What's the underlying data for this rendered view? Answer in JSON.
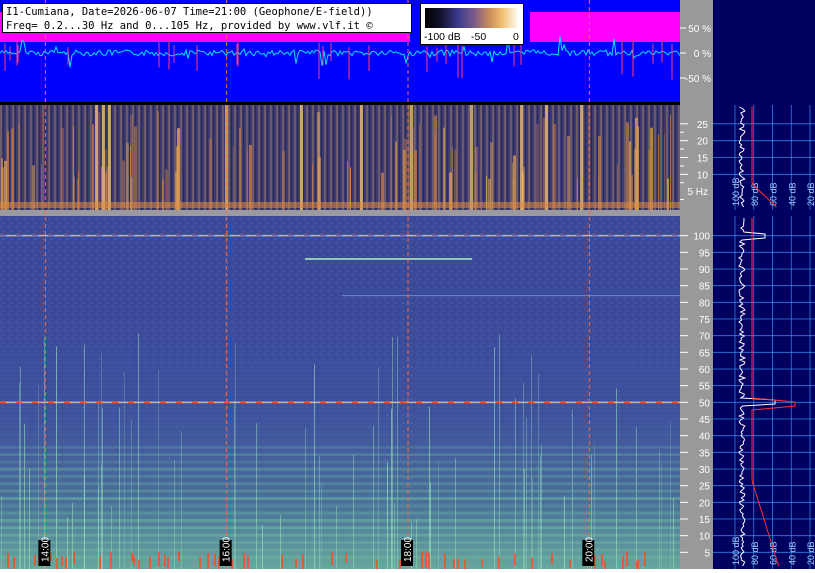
{
  "info": {
    "line1": "I1-Cumiana, Date=2026-06-07 Time=21:00 (Geophone/E-field))",
    "line2": "Freq= 0.2...30 Hz and 0...105 Hz, provided by www.vlf.it ©"
  },
  "colorbar": {
    "min_label": "-100 dB",
    "mid_label": "-50",
    "max_label": "0"
  },
  "colors": {
    "amplitude_bg": "#0000ff",
    "amplitude_trace": "#00e5ff",
    "amplitude_envelope": "#ff00ff",
    "marker_line": "#ff6a3c",
    "tick_panel": "#999999",
    "profile_bg": "#000060",
    "profile_grid": "#3ca0ff"
  },
  "chart_data": [
    {
      "type": "line",
      "panel": "amplitude",
      "y_ticks": [
        "50 %",
        "0 %",
        "-50 %"
      ],
      "y_values": [
        50,
        0,
        -50
      ]
    },
    {
      "type": "heatmap",
      "panel": "spectrogram-low",
      "unit_label": "5 Hz",
      "y_ticks": [
        "25",
        "20",
        "15",
        "10"
      ],
      "y_values": [
        25,
        20,
        15,
        10
      ],
      "ylim": [
        0,
        30
      ],
      "profile_axis_labels": [
        "100 dB",
        "80 dB",
        "60 dB",
        "40 dB",
        "20 dB"
      ]
    },
    {
      "type": "heatmap",
      "panel": "spectrogram-high",
      "y_ticks": [
        "100",
        "95",
        "90",
        "85",
        "80",
        "75",
        "70",
        "65",
        "60",
        "55",
        "50",
        "45",
        "40",
        "35",
        "30",
        "25",
        "20",
        "15",
        "10",
        "5"
      ],
      "y_values": [
        100,
        95,
        90,
        85,
        80,
        75,
        70,
        65,
        60,
        55,
        50,
        45,
        40,
        35,
        30,
        25,
        20,
        15,
        10,
        5
      ],
      "ylim": [
        0,
        105
      ],
      "time_labels": [
        "14:00",
        "16:00",
        "18:00",
        "20:00"
      ],
      "time_values": [
        14,
        16,
        18,
        20
      ],
      "xlim": [
        13.5,
        21.0
      ],
      "profile_axis_labels": [
        "100 dB",
        "80 dB",
        "60 dB",
        "40 dB",
        "20 dB"
      ],
      "spectral_lines_hz": [
        50,
        100
      ]
    }
  ]
}
